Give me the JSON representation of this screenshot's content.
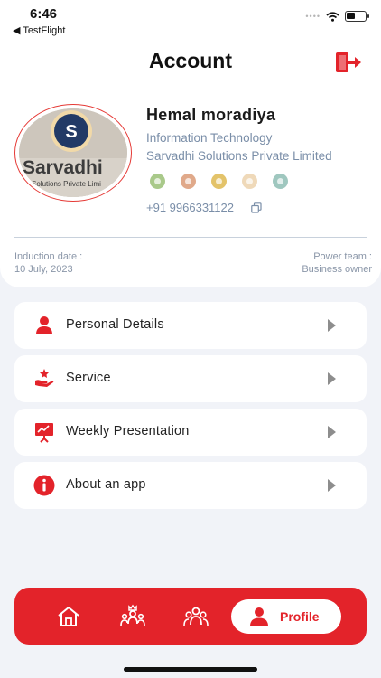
{
  "status_bar": {
    "time": "6:46",
    "back_label": "◀ TestFlight",
    "signal_dots": "••••"
  },
  "header": {
    "title": "Account"
  },
  "profile": {
    "name": "Hemal moradiya",
    "department": "Information Technology",
    "company": "Sarvadhi Solutions Private Limited",
    "phone": "+91 9966331122",
    "avatar_text": {
      "brand": "Sarvadhi",
      "tagline": "Solutions Private Limi",
      "logo_letter": "S"
    },
    "badges": [
      "badge-green",
      "badge-bronze",
      "badge-gold",
      "badge-ribbon",
      "badge-teal"
    ]
  },
  "meta": {
    "induction_label": "Induction date :",
    "induction_value": "10 July, 2023",
    "power_team_label": "Power team :",
    "power_team_value": "Business owner"
  },
  "menu": [
    {
      "label": "Personal Details",
      "icon": "person-icon"
    },
    {
      "label": "Service",
      "icon": "service-icon"
    },
    {
      "label": "Weekly Presentation",
      "icon": "presentation-icon"
    },
    {
      "label": "About an app",
      "icon": "info-icon"
    }
  ],
  "tabbar": {
    "active_label": "Profile"
  },
  "colors": {
    "accent": "#e3232a",
    "muted_text": "#7a8ea8",
    "background": "#f1f3f8"
  }
}
